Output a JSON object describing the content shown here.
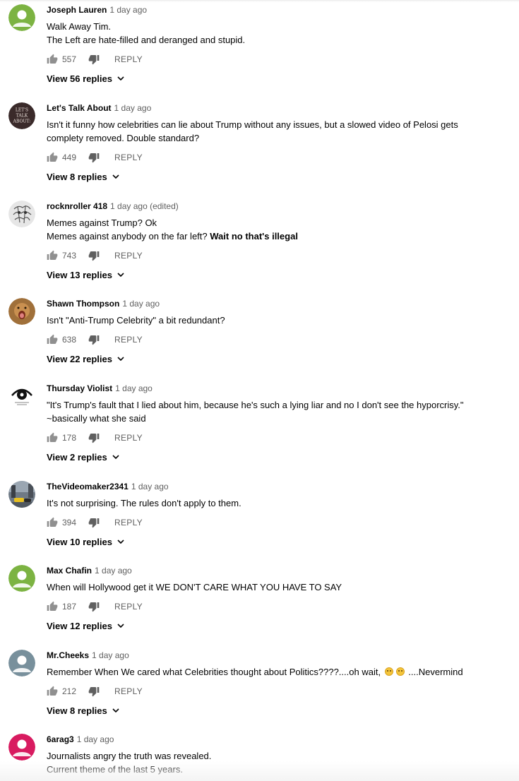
{
  "comments": [
    {
      "author": "Joseph Lauren",
      "time": "1 day ago",
      "lines": [
        "Walk Away Tim.",
        "The Left are hate-filled and deranged and stupid."
      ],
      "likes": "557",
      "reply_label": "REPLY",
      "view_replies": "View 56 replies",
      "avatar": "default-green-avatar",
      "avatar_color": "#7cb342"
    },
    {
      "author": "Let's Talk About",
      "time": "1 day ago",
      "lines": [
        "Isn't it funny how celebrities can lie about Trump without any issues, but a slowed video of Pelosi gets",
        "complety removed. Double standard?"
      ],
      "likes": "449",
      "reply_label": "REPLY",
      "view_replies": "View 8 replies",
      "avatar": "lets-talk-about-logo",
      "avatar_text": [
        "LET'S",
        "TALK",
        "ABOUT:"
      ]
    },
    {
      "author": "rocknroller 418",
      "time": "1 day ago (edited)",
      "lines": [
        "Memes against Trump? Ok"
      ],
      "line2_prefix": "Memes against anybody on the far left? ",
      "line2_bold": "Wait no that's illegal",
      "likes": "743",
      "reply_label": "REPLY",
      "view_replies": "View 13 replies",
      "avatar": "sketch-drawing-avatar"
    },
    {
      "author": "Shawn Thompson",
      "time": "1 day ago",
      "lines": [
        "Isn't \"Anti-Trump Celebrity\" a bit redundant?"
      ],
      "likes": "638",
      "reply_label": "REPLY",
      "view_replies": "View 22 replies",
      "avatar": "lion-photo-avatar"
    },
    {
      "author": "Thursday Violist",
      "time": "1 day ago",
      "lines": [
        "\"It's Trump's fault that I lied about him, because he's such a lying liar and no I don't see the hyporcrisy.\"",
        "~basically what she said"
      ],
      "likes": "178",
      "reply_label": "REPLY",
      "view_replies": "View 2 replies",
      "avatar": "eye-logo-avatar"
    },
    {
      "author": "TheVideomaker2341",
      "time": "1 day ago",
      "lines": [
        "It's not surprising. The rules don't apply to them."
      ],
      "likes": "394",
      "reply_label": "REPLY",
      "view_replies": "View 10 replies",
      "avatar": "street-photo-avatar"
    },
    {
      "author": "Max Chafin",
      "time": "1 day ago",
      "lines": [
        "When will Hollywood get it WE DON'T CARE WHAT YOU HAVE TO SAY"
      ],
      "likes": "187",
      "reply_label": "REPLY",
      "view_replies": "View 12 replies",
      "avatar": "default-green-avatar",
      "avatar_color": "#7cb342"
    },
    {
      "author": "Mr.Cheeks",
      "time": "1 day ago",
      "line_prefix": "Remember When We cared what Celebrities thought about Politics????....oh wait, ",
      "line_suffix": " ....Nevermind",
      "emoji_icon": "flushed-face-emoji",
      "likes": "212",
      "reply_label": "REPLY",
      "view_replies": "View 8 replies",
      "avatar": "default-gray-avatar",
      "avatar_color": "#78909c"
    },
    {
      "author": "6arag3",
      "time": "1 day ago",
      "lines": [
        "Journalists angry the truth was revealed.",
        "Current theme of the last 5 years."
      ],
      "avatar": "default-pink-avatar",
      "avatar_color": "#d81b60"
    }
  ]
}
